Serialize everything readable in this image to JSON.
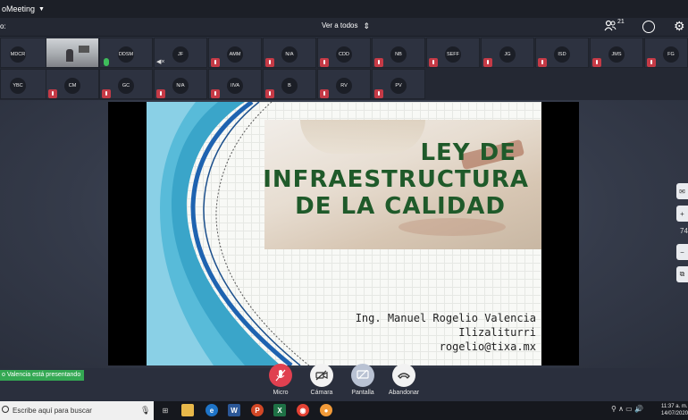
{
  "app": {
    "title": "oMeeting"
  },
  "toolbar": {
    "left_label": "o:",
    "view_all": "Ver a todos",
    "participant_count": "21"
  },
  "participants": {
    "row1": [
      "MDCR",
      "",
      "DDSM",
      "JF",
      "AMM",
      "N/A",
      "CDD",
      "NB",
      "SEFF",
      "JG",
      "ISD",
      "JMS",
      "FG"
    ],
    "row2": [
      "YBC",
      "CM",
      "GC",
      "N/A",
      "IIVA",
      "B",
      "RV",
      "PV"
    ]
  },
  "slide": {
    "title_line1": "LEY DE",
    "title_line2": "INFRAESTRUCTURA",
    "title_line3": "DE LA CALIDAD",
    "author_line1": "Ing. Manuel Rogelio Valencia",
    "author_line2": "Ilizaliturri",
    "email": "rogelio@tixa.mx"
  },
  "side": {
    "value": "74"
  },
  "presenting_notice": "o Valencia está presentando",
  "controls": {
    "micro": "Micro",
    "camera": "Cámara",
    "screen": "Pantalla",
    "leave": "Abandonar"
  },
  "taskbar": {
    "search_placeholder": "Escribe aquí para buscar",
    "time": "11:37 a. m.",
    "date": "14/07/2020"
  },
  "colors": {
    "mute_red": "#c53a46",
    "title_green": "#1f5a2a",
    "presenting_green": "#34a853"
  }
}
